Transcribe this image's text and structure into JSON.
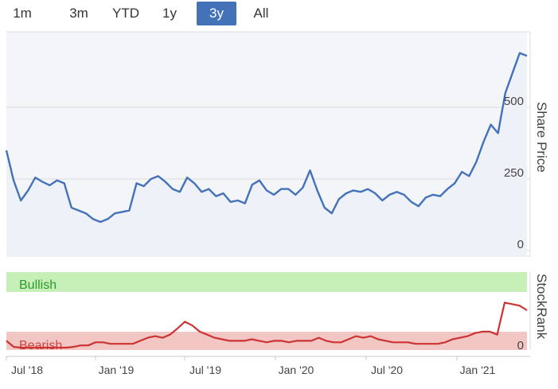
{
  "range_selector": {
    "buttons": [
      {
        "label": "1m",
        "active": false
      },
      {
        "label": "3m",
        "active": false
      },
      {
        "label": "YTD",
        "active": false
      },
      {
        "label": "1y",
        "active": false
      },
      {
        "label": "3y",
        "active": true
      },
      {
        "label": "All",
        "active": false
      }
    ]
  },
  "colors": {
    "price_line": "#4472b8",
    "price_fill": "#f4f5f9",
    "rank_line": "#cc3333",
    "bullish_band": "#c6f0b8",
    "bearish_band": "#f2c6c3",
    "bullish_text": "#2e9a2e",
    "bearish_text": "#cc4444",
    "grid": "#dcdcdc",
    "active_button": "#4472b8"
  },
  "chart_data": [
    {
      "type": "line",
      "ylabel": "Share Price",
      "ylim": [
        0,
        700
      ],
      "yticks": [
        0,
        250,
        500
      ],
      "grid": true,
      "series": [
        {
          "x": [
            "Jun '18",
            "Jun '18",
            "Jul '18",
            "Jul '18",
            "Aug '18",
            "Aug '18",
            "Aug '18",
            "Sep '18",
            "Sep '18",
            "Oct '18",
            "Oct '18",
            "Nov '18",
            "Nov '18",
            "Dec '18",
            "Dec '18",
            "Jan '19",
            "Jan '19",
            "Feb '19",
            "Feb '19",
            "Mar '19",
            "Mar '19",
            "Apr '19",
            "Apr '19",
            "May '19",
            "May '19",
            "Jun '19",
            "Jun '19",
            "Jul '19",
            "Jul '19",
            "Aug '19",
            "Aug '19",
            "Sep '19",
            "Sep '19",
            "Oct '19",
            "Oct '19",
            "Nov '19",
            "Nov '19",
            "Dec '19",
            "Dec '19",
            "Jan '20",
            "Jan '20",
            "Feb '20",
            "Feb '20",
            "Mar '20",
            "Mar '20",
            "Apr '20",
            "Apr '20",
            "May '20",
            "May '20",
            "Jun '20",
            "Jun '20",
            "Jul '20",
            "Jul '20",
            "Aug '20",
            "Aug '20",
            "Sep '20",
            "Sep '20",
            "Oct '20",
            "Oct '20",
            "Nov '20",
            "Nov '20",
            "Dec '20",
            "Dec '20",
            "Jan '21",
            "Jan '21",
            "Feb '21",
            "Feb '21",
            "Mar '21",
            "Mar '21",
            "Mar '21",
            "Apr '21",
            "Apr '21",
            "Apr '21"
          ],
          "values": [
            350,
            245,
            175,
            210,
            255,
            240,
            228,
            245,
            235,
            150,
            140,
            130,
            110,
            100,
            110,
            130,
            135,
            140,
            235,
            225,
            250,
            260,
            240,
            215,
            205,
            255,
            235,
            205,
            215,
            190,
            200,
            170,
            175,
            165,
            230,
            245,
            210,
            195,
            215,
            215,
            195,
            220,
            280,
            210,
            150,
            130,
            180,
            200,
            210,
            205,
            215,
            200,
            175,
            195,
            205,
            195,
            170,
            155,
            185,
            195,
            190,
            215,
            235,
            275,
            260,
            310,
            380,
            440,
            410,
            550,
            620,
            690,
            680
          ]
        }
      ]
    },
    {
      "type": "line",
      "ylabel": "StockRank",
      "yticks": [
        0
      ],
      "bands": [
        {
          "label": "Bullish"
        },
        {
          "label": "Bearish"
        }
      ],
      "series": [
        {
          "values": [
            10,
            2,
            1,
            1,
            1,
            1,
            1,
            1,
            1,
            2,
            4,
            4,
            8,
            8,
            6,
            6,
            6,
            6,
            10,
            14,
            16,
            14,
            18,
            26,
            35,
            30,
            22,
            18,
            14,
            12,
            10,
            10,
            10,
            12,
            10,
            8,
            10,
            10,
            8,
            10,
            10,
            10,
            14,
            10,
            8,
            8,
            12,
            16,
            14,
            16,
            12,
            10,
            8,
            8,
            8,
            6,
            6,
            6,
            6,
            8,
            12,
            14,
            16,
            20,
            22,
            22,
            18,
            60,
            58,
            56,
            50
          ]
        }
      ]
    },
    {
      "type": "table",
      "xticks": [
        "Jul '18",
        "Jan '19",
        "Jul '19",
        "Jan '20",
        "Jul '20",
        "Jan '21"
      ]
    }
  ]
}
